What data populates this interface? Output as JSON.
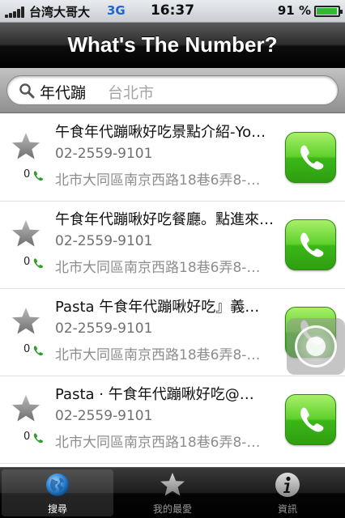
{
  "status_bar": {
    "carrier": "台湾大哥大",
    "network": "3G",
    "time": "16:37",
    "battery_text": "91 %",
    "battery_level": 0.91,
    "signal_bars": 5
  },
  "nav": {
    "title": "What's The Number?"
  },
  "search": {
    "query": "年代蹦",
    "location_hint": "台北市",
    "icon": "search-icon"
  },
  "results": [
    {
      "title": "午食年代蹦啾好吃景點介紹-Yo…",
      "phone": "02-2559-9101",
      "address": "北市大同區南京西路18巷6弄8-…",
      "call_count": "0"
    },
    {
      "title": "午食年代蹦啾好吃餐廳。點進來…",
      "phone": "02-2559-9101",
      "address": "北市大同區南京西路18巷6弄8-…",
      "call_count": "0"
    },
    {
      "title": " Pasta 午食年代蹦啾好吃』義…",
      "phone": "02-2559-9101",
      "address": "北市大同區南京西路18巷6弄8-…",
      "call_count": "0"
    },
    {
      "title": " Pasta · 午食年代蹦啾好吃@…",
      "phone": "02-2559-9101",
      "address": "北市大同區南京西路18巷6弄8-…",
      "call_count": "0"
    }
  ],
  "tabs": [
    {
      "label": "搜尋",
      "icon": "globe-icon",
      "active": true
    },
    {
      "label": "我的最愛",
      "icon": "star-icon",
      "active": false
    },
    {
      "label": "資訊",
      "icon": "info-icon",
      "active": false
    }
  ],
  "colors": {
    "call_button_green": "#4cc321",
    "nav_bar": "#1a1a1a",
    "network_blue": "#2266cc",
    "battery_green": "#31b936"
  }
}
